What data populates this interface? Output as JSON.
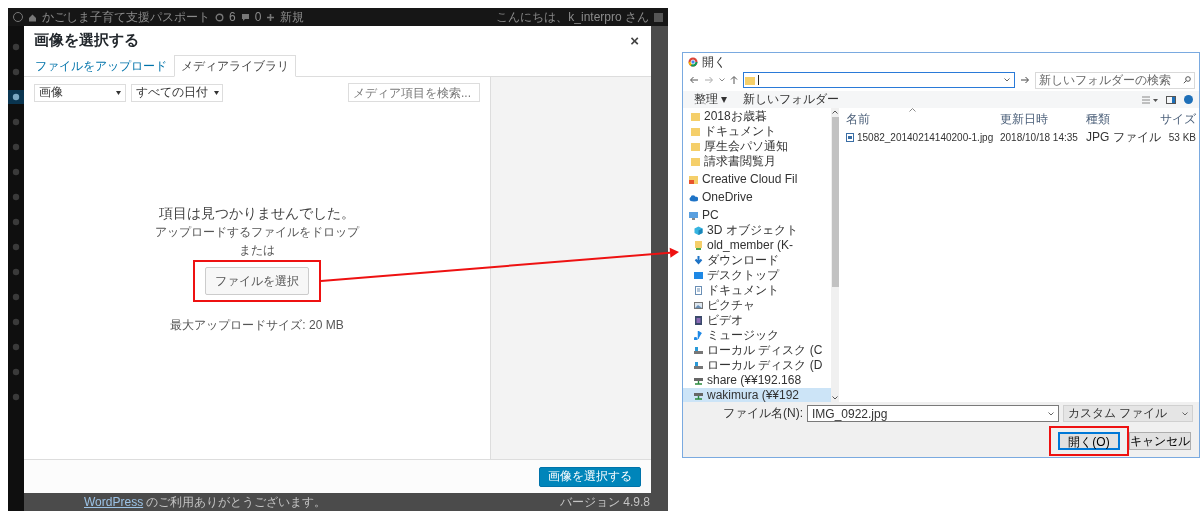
{
  "admin_bar": {
    "site_name": "かごしま子育て支援パスポート",
    "updates_count": "6",
    "comments_count": "0",
    "new_label": "新規",
    "greeting": "こんにちは、k_interpro さん"
  },
  "admin_menu": [
    {
      "selected": false
    },
    {
      "selected": false
    },
    {
      "selected": true
    },
    {
      "selected": false
    },
    {
      "selected": false
    },
    {
      "selected": false
    },
    {
      "selected": false
    },
    {
      "selected": false
    },
    {
      "selected": false
    },
    {
      "selected": false
    },
    {
      "selected": false
    },
    {
      "selected": false
    },
    {
      "selected": false
    },
    {
      "selected": false
    },
    {
      "selected": false
    }
  ],
  "modal": {
    "title": "画像を選択する",
    "close": "×",
    "tabs": [
      {
        "label": "ファイルをアップロード",
        "selected": false
      },
      {
        "label": "メディアライブラリ",
        "selected": true
      }
    ],
    "filters": [
      {
        "value": "画像"
      },
      {
        "value": "すべての日付"
      }
    ],
    "search": {
      "placeholder": "メディア項目を検索..."
    },
    "empty": {
      "message": "項目は見つかりませんでした。",
      "drop_hint": "アップロードするファイルをドロップ",
      "or_text": "または",
      "select_button": "ファイルを選択",
      "max_size": "最大アップロードサイズ: 20 MB"
    },
    "primary_button": "画像を選択する"
  },
  "footer": {
    "link": "WordPress",
    "thanks": "のご利用ありがとうございます。",
    "version": "バージョン 4.9.8"
  },
  "file_dialog": {
    "title": "開く",
    "search": {
      "placeholder": "新しいフォルダーの検索"
    },
    "toolbar": [
      {
        "label": "整理 ▾"
      },
      {
        "label": "新しいフォルダー"
      }
    ],
    "nav": [
      {
        "label": "2018お歳暮",
        "kind": "folder",
        "selected": false
      },
      {
        "label": "ドキュメント",
        "kind": "folder",
        "selected": false
      },
      {
        "label": "厚生会パソ通知",
        "kind": "folder",
        "selected": false
      },
      {
        "label": "請求書閲覧月",
        "kind": "folder",
        "selected": false
      },
      {
        "label": "Creative Cloud Fil",
        "kind": "cloud-folder",
        "selected": false
      },
      {
        "label": "OneDrive",
        "kind": "onedrive",
        "selected": false
      },
      {
        "label": "PC",
        "kind": "pc",
        "selected": false,
        "children": [
          {
            "label": "3D オブジェクト",
            "kind": "cube",
            "selected": false
          },
          {
            "label": "old_member (K-",
            "kind": "user-folder",
            "selected": false
          },
          {
            "label": "ダウンロード",
            "kind": "download",
            "selected": false
          },
          {
            "label": "デスクトップ",
            "kind": "desktop",
            "selected": false
          },
          {
            "label": "ドキュメント",
            "kind": "document",
            "selected": false
          },
          {
            "label": "ピクチャ",
            "kind": "picture",
            "selected": false
          },
          {
            "label": "ビデオ",
            "kind": "video",
            "selected": false
          },
          {
            "label": "ミュージック",
            "kind": "music",
            "selected": false
          },
          {
            "label": "ローカル ディスク (C",
            "kind": "local-drive",
            "selected": false
          },
          {
            "label": "ローカル ディスク (D",
            "kind": "local-drive",
            "selected": false
          },
          {
            "label": "share (¥¥192.168",
            "kind": "network-drive",
            "selected": false
          },
          {
            "label": "wakimura (¥¥192",
            "kind": "network-drive",
            "selected": true
          }
        ]
      }
    ],
    "columns": [
      "名前",
      "更新日時",
      "種類",
      "サイズ"
    ],
    "rows": [
      [
        "15082_20140214140200-1.jpg",
        "2018/10/18 14:35",
        "JPG ファイル",
        "53 KB"
      ]
    ],
    "filename_label": "ファイル名(N):",
    "filename": "IMG_0922.jpg",
    "filter": "カスタム ファイル",
    "open_button": "開く(O)",
    "cancel_button": "キャンセル"
  },
  "callouts": [
    {
      "kind": "select-frame"
    },
    {
      "kind": "open-frame"
    },
    {
      "kind": "arrow"
    }
  ]
}
